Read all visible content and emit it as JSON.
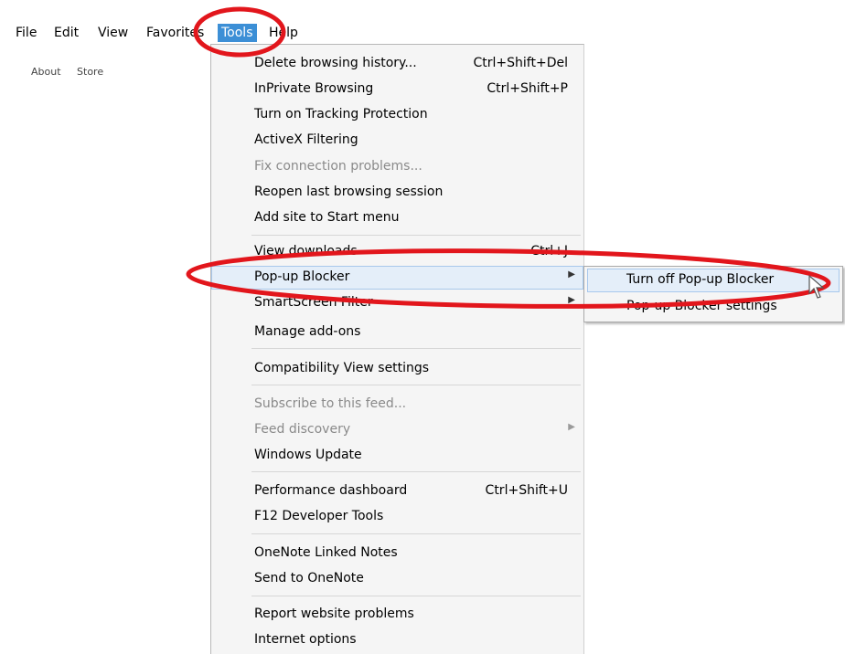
{
  "menubar": {
    "items": [
      {
        "label": "File"
      },
      {
        "label": "Edit"
      },
      {
        "label": "View"
      },
      {
        "label": "Favorites"
      },
      {
        "label": "Tools"
      },
      {
        "label": "Help"
      }
    ]
  },
  "page_links": {
    "about": "About",
    "store": "Store"
  },
  "tools_menu": {
    "items": [
      {
        "label": "Delete browsing history...",
        "shortcut": "Ctrl+Shift+Del"
      },
      {
        "label": "InPrivate Browsing",
        "shortcut": "Ctrl+Shift+P"
      },
      {
        "label": "Turn on Tracking Protection"
      },
      {
        "label": "ActiveX Filtering"
      },
      {
        "label": "Fix connection problems..."
      },
      {
        "label": "Reopen last browsing session"
      },
      {
        "label": "Add site to Start menu"
      },
      {
        "label": "View downloads",
        "shortcut": "Ctrl+J"
      },
      {
        "label": "Pop-up Blocker"
      },
      {
        "label": "SmartScreen Filter"
      },
      {
        "label": "Manage add-ons"
      },
      {
        "label": "Compatibility View settings"
      },
      {
        "label": "Subscribe to this feed..."
      },
      {
        "label": "Feed discovery"
      },
      {
        "label": "Windows Update"
      },
      {
        "label": "Performance dashboard",
        "shortcut": "Ctrl+Shift+U"
      },
      {
        "label": "F12 Developer Tools"
      },
      {
        "label": "OneNote Linked Notes"
      },
      {
        "label": "Send to OneNote"
      },
      {
        "label": "Report website problems"
      },
      {
        "label": "Internet options"
      }
    ]
  },
  "popup_submenu": {
    "items": [
      {
        "label": "Turn off Pop-up Blocker"
      },
      {
        "label": "Pop-up Blocker settings"
      }
    ]
  },
  "colors": {
    "highlight": "#3c8fd6",
    "annotation": "#e2161c",
    "hover": "#e4eef9"
  }
}
